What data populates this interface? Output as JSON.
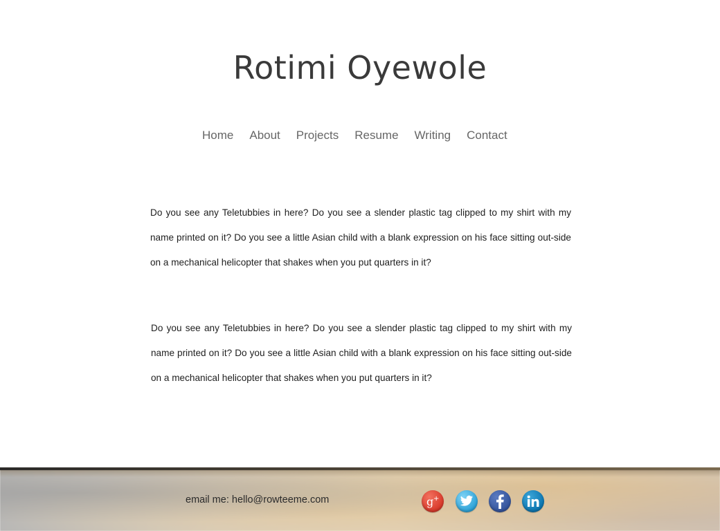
{
  "site": {
    "title": "Rotimi Oyewole"
  },
  "nav": {
    "items": [
      {
        "label": "Home"
      },
      {
        "label": "About"
      },
      {
        "label": "Projects"
      },
      {
        "label": "Resume"
      },
      {
        "label": "Writing"
      },
      {
        "label": "Contact"
      }
    ]
  },
  "content": {
    "paragraphs": [
      "Do you see any Teletubbies in here? Do you see a slender plastic tag clipped to my shirt with my name printed on it? Do you see a little Asian child with a blank expression on his face sitting out-side on a mechanical helicopter that shakes when you put quarters in it?",
      "Do you see any Teletubbies in here? Do you see a slender plastic tag clipped to my shirt with my name printed on it? Do you see a little Asian child with a blank expression on his face sitting out-side on a mechanical helicopter that shakes when you put quarters in it?"
    ]
  },
  "footer": {
    "email_prefix": "email me: ",
    "email": "hello@rowteeme.com",
    "social": [
      {
        "icon": "google-plus-icon",
        "color": "#d8392a"
      },
      {
        "icon": "twitter-icon",
        "color": "#2ea3d8"
      },
      {
        "icon": "facebook-icon",
        "color": "#34549c"
      },
      {
        "icon": "linkedin-icon",
        "color": "#0d76b0"
      }
    ]
  }
}
